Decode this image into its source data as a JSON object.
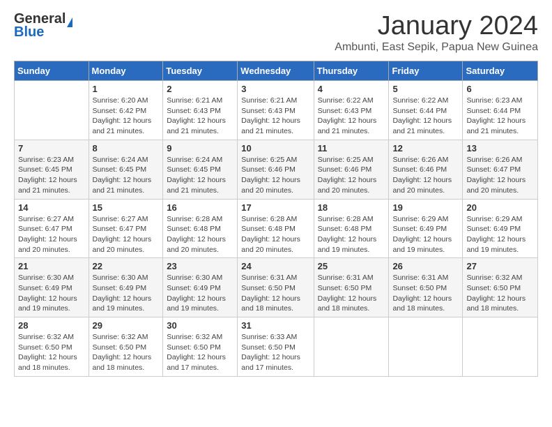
{
  "header": {
    "logo": {
      "general": "General",
      "blue": "Blue"
    },
    "title": "January 2024",
    "subtitle": "Ambunti, East Sepik, Papua New Guinea"
  },
  "calendar": {
    "weekdays": [
      "Sunday",
      "Monday",
      "Tuesday",
      "Wednesday",
      "Thursday",
      "Friday",
      "Saturday"
    ],
    "weeks": [
      [
        {
          "day": "",
          "info": ""
        },
        {
          "day": "1",
          "info": "Sunrise: 6:20 AM\nSunset: 6:42 PM\nDaylight: 12 hours and 21 minutes."
        },
        {
          "day": "2",
          "info": "Sunrise: 6:21 AM\nSunset: 6:43 PM\nDaylight: 12 hours and 21 minutes."
        },
        {
          "day": "3",
          "info": "Sunrise: 6:21 AM\nSunset: 6:43 PM\nDaylight: 12 hours and 21 minutes."
        },
        {
          "day": "4",
          "info": "Sunrise: 6:22 AM\nSunset: 6:43 PM\nDaylight: 12 hours and 21 minutes."
        },
        {
          "day": "5",
          "info": "Sunrise: 6:22 AM\nSunset: 6:44 PM\nDaylight: 12 hours and 21 minutes."
        },
        {
          "day": "6",
          "info": "Sunrise: 6:23 AM\nSunset: 6:44 PM\nDaylight: 12 hours and 21 minutes."
        }
      ],
      [
        {
          "day": "7",
          "info": "Sunrise: 6:23 AM\nSunset: 6:45 PM\nDaylight: 12 hours and 21 minutes."
        },
        {
          "day": "8",
          "info": "Sunrise: 6:24 AM\nSunset: 6:45 PM\nDaylight: 12 hours and 21 minutes."
        },
        {
          "day": "9",
          "info": "Sunrise: 6:24 AM\nSunset: 6:45 PM\nDaylight: 12 hours and 21 minutes."
        },
        {
          "day": "10",
          "info": "Sunrise: 6:25 AM\nSunset: 6:46 PM\nDaylight: 12 hours and 20 minutes."
        },
        {
          "day": "11",
          "info": "Sunrise: 6:25 AM\nSunset: 6:46 PM\nDaylight: 12 hours and 20 minutes."
        },
        {
          "day": "12",
          "info": "Sunrise: 6:26 AM\nSunset: 6:46 PM\nDaylight: 12 hours and 20 minutes."
        },
        {
          "day": "13",
          "info": "Sunrise: 6:26 AM\nSunset: 6:47 PM\nDaylight: 12 hours and 20 minutes."
        }
      ],
      [
        {
          "day": "14",
          "info": "Sunrise: 6:27 AM\nSunset: 6:47 PM\nDaylight: 12 hours and 20 minutes."
        },
        {
          "day": "15",
          "info": "Sunrise: 6:27 AM\nSunset: 6:47 PM\nDaylight: 12 hours and 20 minutes."
        },
        {
          "day": "16",
          "info": "Sunrise: 6:28 AM\nSunset: 6:48 PM\nDaylight: 12 hours and 20 minutes."
        },
        {
          "day": "17",
          "info": "Sunrise: 6:28 AM\nSunset: 6:48 PM\nDaylight: 12 hours and 20 minutes."
        },
        {
          "day": "18",
          "info": "Sunrise: 6:28 AM\nSunset: 6:48 PM\nDaylight: 12 hours and 19 minutes."
        },
        {
          "day": "19",
          "info": "Sunrise: 6:29 AM\nSunset: 6:49 PM\nDaylight: 12 hours and 19 minutes."
        },
        {
          "day": "20",
          "info": "Sunrise: 6:29 AM\nSunset: 6:49 PM\nDaylight: 12 hours and 19 minutes."
        }
      ],
      [
        {
          "day": "21",
          "info": "Sunrise: 6:30 AM\nSunset: 6:49 PM\nDaylight: 12 hours and 19 minutes."
        },
        {
          "day": "22",
          "info": "Sunrise: 6:30 AM\nSunset: 6:49 PM\nDaylight: 12 hours and 19 minutes."
        },
        {
          "day": "23",
          "info": "Sunrise: 6:30 AM\nSunset: 6:49 PM\nDaylight: 12 hours and 19 minutes."
        },
        {
          "day": "24",
          "info": "Sunrise: 6:31 AM\nSunset: 6:50 PM\nDaylight: 12 hours and 18 minutes."
        },
        {
          "day": "25",
          "info": "Sunrise: 6:31 AM\nSunset: 6:50 PM\nDaylight: 12 hours and 18 minutes."
        },
        {
          "day": "26",
          "info": "Sunrise: 6:31 AM\nSunset: 6:50 PM\nDaylight: 12 hours and 18 minutes."
        },
        {
          "day": "27",
          "info": "Sunrise: 6:32 AM\nSunset: 6:50 PM\nDaylight: 12 hours and 18 minutes."
        }
      ],
      [
        {
          "day": "28",
          "info": "Sunrise: 6:32 AM\nSunset: 6:50 PM\nDaylight: 12 hours and 18 minutes."
        },
        {
          "day": "29",
          "info": "Sunrise: 6:32 AM\nSunset: 6:50 PM\nDaylight: 12 hours and 18 minutes."
        },
        {
          "day": "30",
          "info": "Sunrise: 6:32 AM\nSunset: 6:50 PM\nDaylight: 12 hours and 17 minutes."
        },
        {
          "day": "31",
          "info": "Sunrise: 6:33 AM\nSunset: 6:50 PM\nDaylight: 12 hours and 17 minutes."
        },
        {
          "day": "",
          "info": ""
        },
        {
          "day": "",
          "info": ""
        },
        {
          "day": "",
          "info": ""
        }
      ]
    ]
  }
}
